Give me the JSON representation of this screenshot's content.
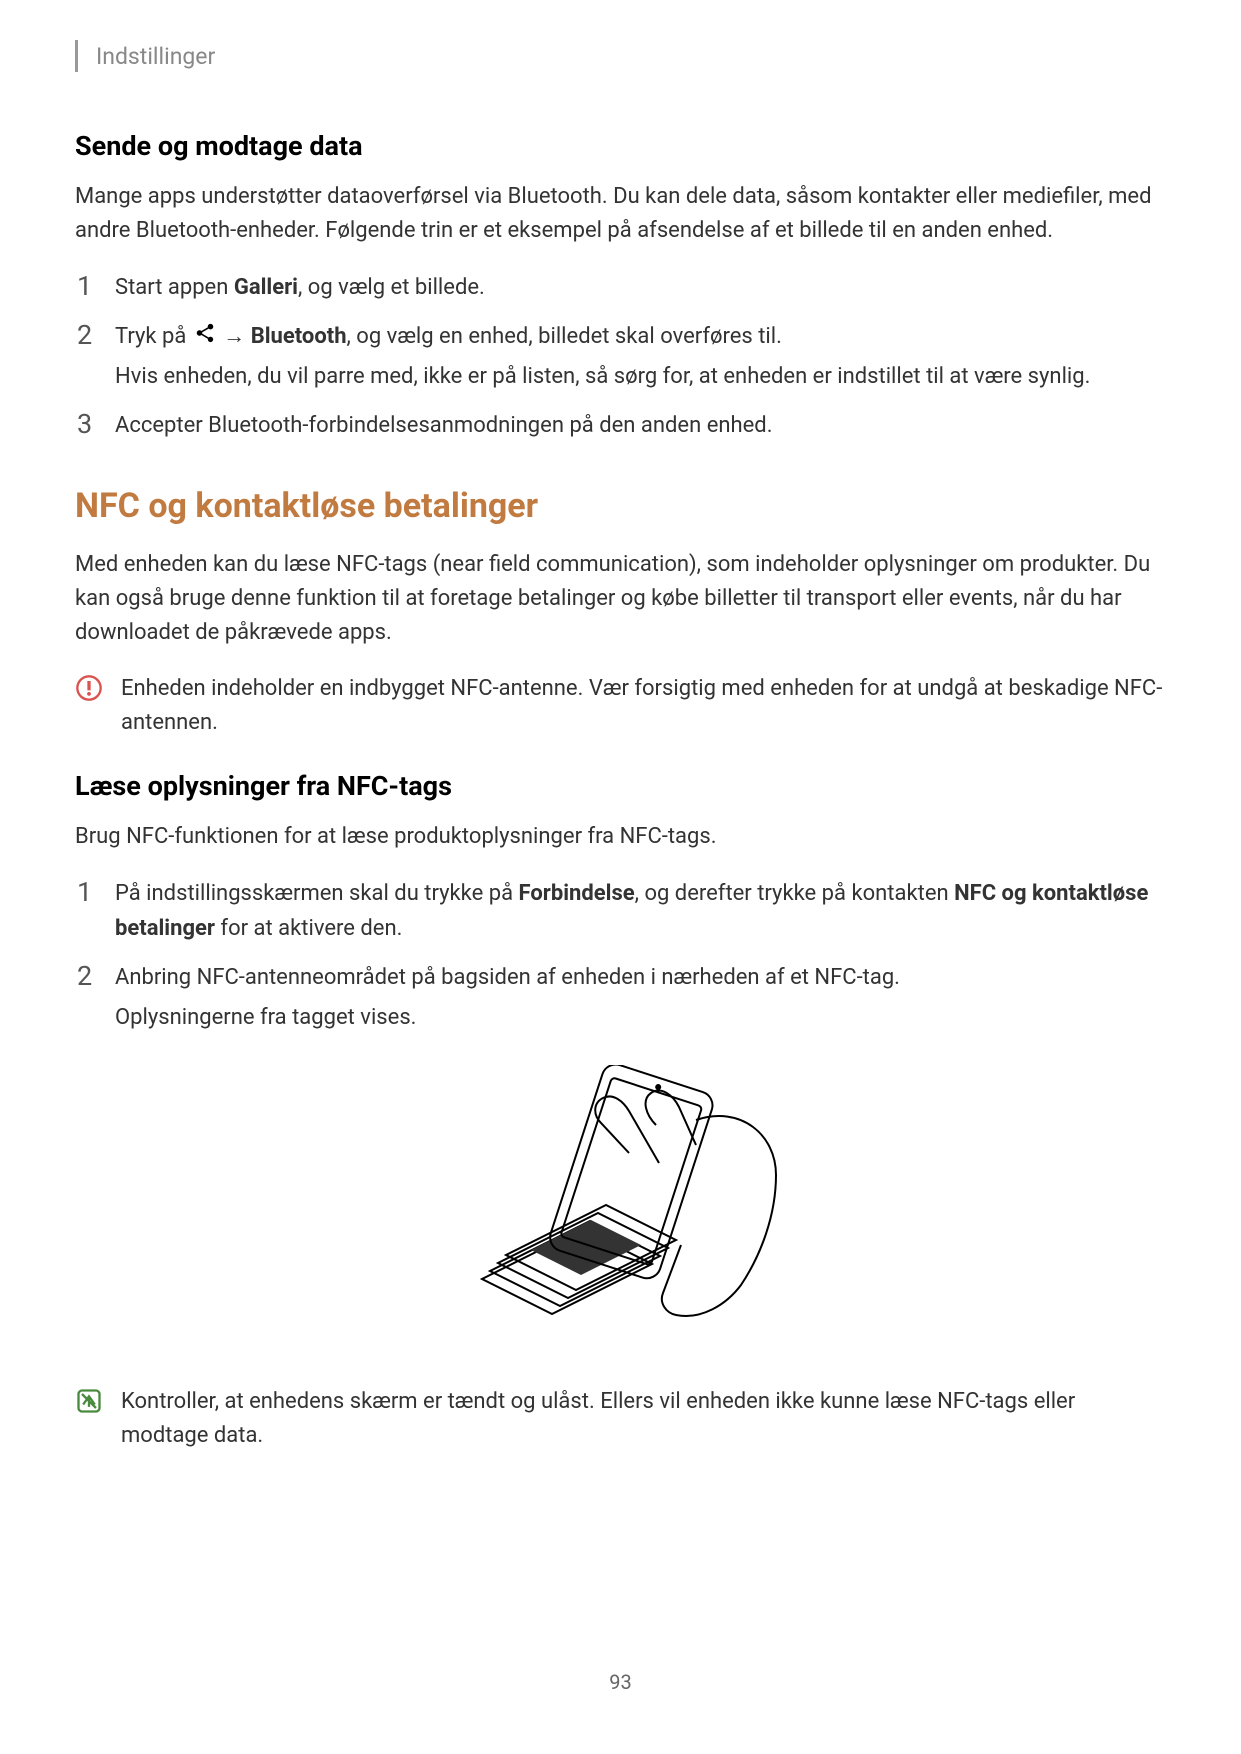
{
  "header": "Indstillinger",
  "section1": {
    "title": "Sende og modtage data",
    "intro": "Mange apps understøtter dataoverførsel via Bluetooth. Du kan dele data, såsom kontakter eller mediefiler, med andre Bluetooth-enheder. Følgende trin er et eksempel på afsendelse af et billede til en anden enhed.",
    "step1_pre": "Start appen ",
    "step1_bold": "Galleri",
    "step1_post": ", og vælg et billede.",
    "step2_pre": "Tryk på ",
    "step2_arrow": " → ",
    "step2_bold": "Bluetooth",
    "step2_post": ", og vælg en enhed, billedet skal overføres til.",
    "step2_sub": "Hvis enheden, du vil parre med, ikke er på listen, så sørg for, at enheden er indstillet til at være synlig.",
    "step3": "Accepter Bluetooth-forbindelsesanmodningen på den anden enhed."
  },
  "section2": {
    "title": "NFC og kontaktløse betalinger",
    "intro": "Med enheden kan du læse NFC-tags (near field communication), som indeholder oplysninger om produkter. Du kan også bruge denne funktion til at foretage betalinger og købe billetter til transport eller events, når du har downloadet de påkrævede apps.",
    "warning": "Enheden indeholder en indbygget NFC-antenne. Vær forsigtig med enheden for at undgå at beskadige NFC-antennen."
  },
  "section3": {
    "title": "Læse oplysninger fra NFC-tags",
    "intro": "Brug NFC-funktionen for at læse produktoplysninger fra NFC-tags.",
    "step1_pre": "På indstillingsskærmen skal du trykke på ",
    "step1_bold1": "Forbindelse",
    "step1_mid": ", og derefter trykke på kontakten ",
    "step1_bold2": "NFC og kontaktløse betalinger",
    "step1_post": " for at aktivere den.",
    "step2_line1": "Anbring NFC-antenneområdet på bagsiden af enheden i nærheden af et NFC-tag.",
    "step2_line2": "Oplysningerne fra tagget vises.",
    "note": "Kontroller, at enhedens skærm er tændt og ulåst. Ellers vil enheden ikke kunne læse NFC-tags eller modtage data."
  },
  "pageNumber": "93"
}
